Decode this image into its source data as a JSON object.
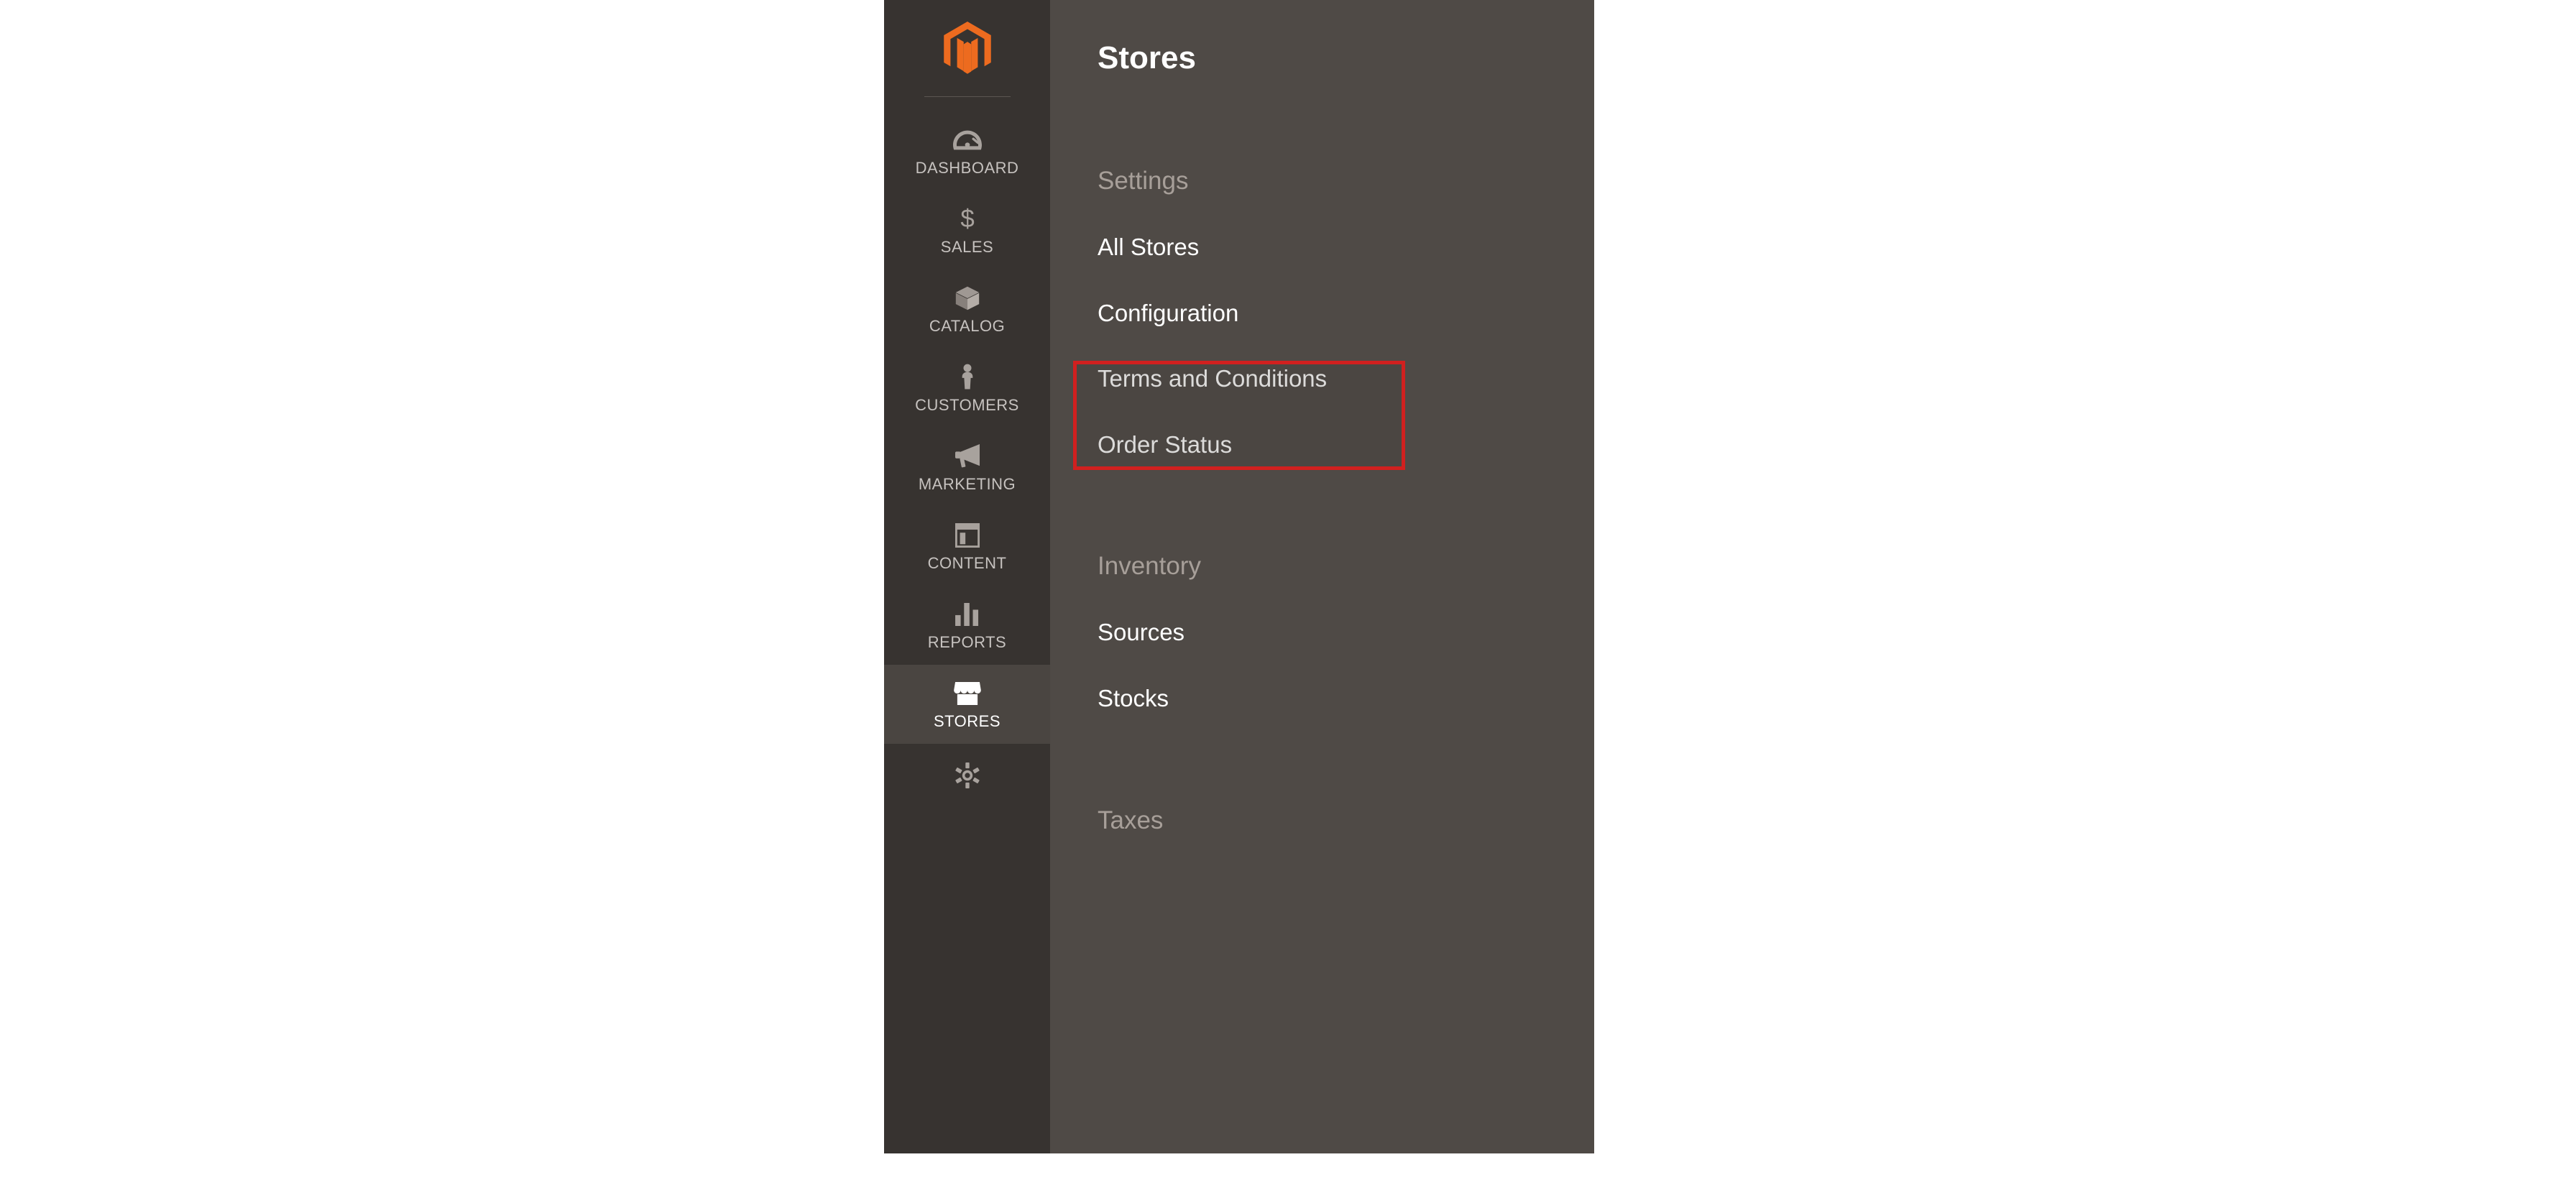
{
  "nav": {
    "items": [
      {
        "label": "DASHBOARD"
      },
      {
        "label": "SALES"
      },
      {
        "label": "CATALOG"
      },
      {
        "label": "CUSTOMERS"
      },
      {
        "label": "MARKETING"
      },
      {
        "label": "CONTENT"
      },
      {
        "label": "REPORTS"
      },
      {
        "label": "STORES"
      }
    ]
  },
  "submenu": {
    "title": "Stores",
    "groups": [
      {
        "heading": "Settings",
        "items": [
          {
            "label": "All Stores"
          },
          {
            "label": "Configuration"
          },
          {
            "label": "Terms and Conditions"
          },
          {
            "label": "Order Status"
          }
        ]
      },
      {
        "heading": "Inventory",
        "items": [
          {
            "label": "Sources"
          },
          {
            "label": "Stocks"
          }
        ]
      },
      {
        "heading": "Taxes",
        "items": []
      }
    ]
  }
}
